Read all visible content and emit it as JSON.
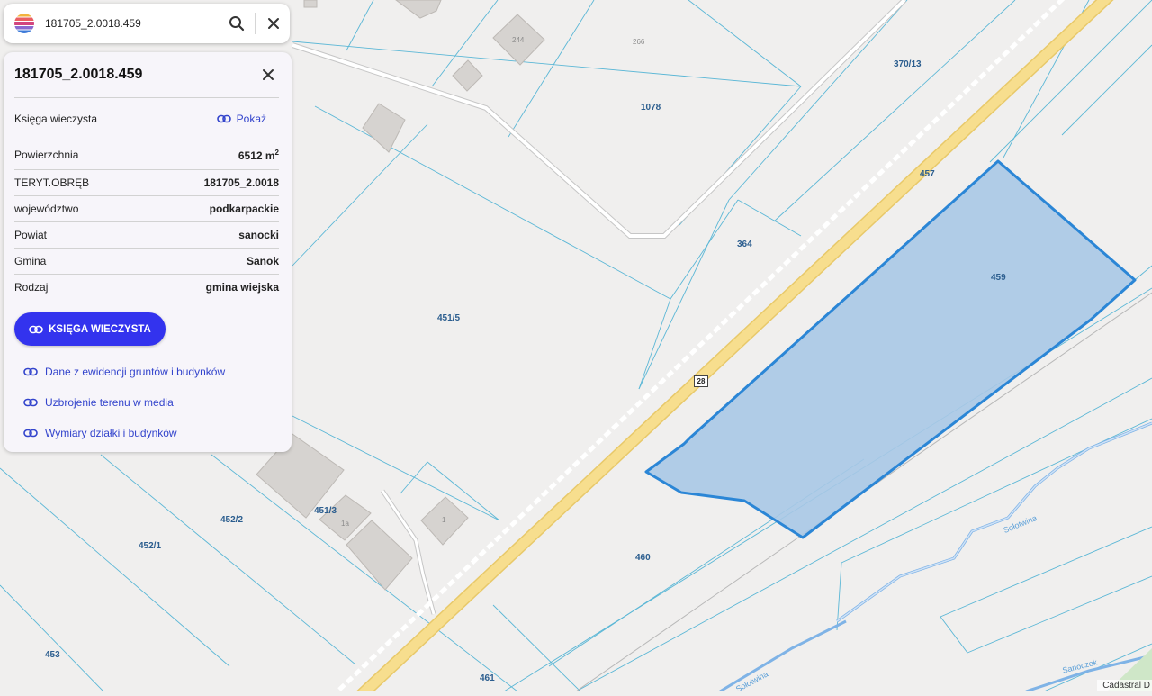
{
  "search": {
    "value": "181705_2.0018.459"
  },
  "panel": {
    "title": "181705_2.0018.459",
    "land_registry_label": "Księga wieczysta",
    "show_link": "Pokaż",
    "rows": [
      {
        "label": "Powierzchnia",
        "value": "6512 m",
        "sup": "2"
      },
      {
        "label": "TERYT.OBRĘB",
        "value": "181705_2.0018"
      },
      {
        "label": "województwo",
        "value": "podkarpackie"
      },
      {
        "label": "Powiat",
        "value": "sanocki"
      },
      {
        "label": "Gmina",
        "value": "Sanok"
      },
      {
        "label": "Rodzaj",
        "value": "gmina wiejska"
      }
    ],
    "cta_button": "KSIĘGA WIECZYSTA",
    "links": [
      "Dane z ewidencji gruntów i budynków",
      "Uzbrojenie terenu w media",
      "Wymiary działki i budynków"
    ]
  },
  "map": {
    "parcel_labels": [
      "370/13",
      "1078",
      "457",
      "364",
      "459",
      "451/5",
      "452/2",
      "451/3",
      "452/1",
      "460",
      "453",
      "461"
    ],
    "building_labels": [
      "244",
      "266",
      "1",
      "1a"
    ],
    "road_number": "28",
    "river_labels": [
      "Sołotwina",
      "Sołotwina",
      "Sanoczek"
    ],
    "attribution": "Cadastral D",
    "colors": {
      "selected_fill": "#a9c8e6",
      "selected_stroke": "#2b86d6",
      "parcel_lines": "#5bb7d6",
      "road": "#f7de8e",
      "panel_button": "#3333ee",
      "link": "#3344cc"
    }
  }
}
